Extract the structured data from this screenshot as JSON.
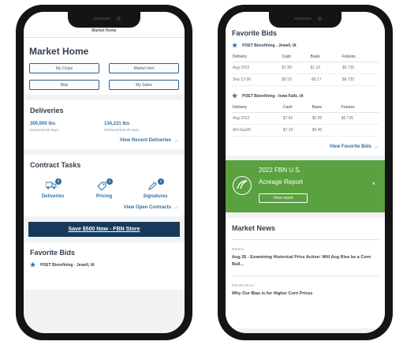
{
  "left_phone": {
    "topbar_title": "Market Home",
    "page_title": "My Crops",
    "market_home_title": "Market Home",
    "quick_buttons": [
      "My Crops",
      "Market Intel",
      "Bids",
      "My Sales"
    ],
    "deliveries": {
      "title": "Deliveries",
      "stats": [
        {
          "value": "300,000 lbs",
          "label": "Delivered 30 days"
        },
        {
          "value": "134,231 lbs",
          "label": "Delivered last 30 days"
        }
      ],
      "link": "View Recent Deliveries"
    },
    "contract_tasks": {
      "title": "Contract Tasks",
      "tasks": [
        {
          "label": "Deliveries",
          "badge": "3",
          "icon": "truck-icon"
        },
        {
          "label": "Pricing",
          "badge": "1",
          "icon": "tag-icon"
        },
        {
          "label": "Signatures",
          "badge": "2",
          "icon": "pen-icon"
        }
      ],
      "link": "View Open Contracts"
    },
    "store_banner": "Save $500 Now - FBN Store",
    "favorite_bids_title": "Favorite Bids",
    "favorite_bids_first": "POET Biorefining - Jewell, IA"
  },
  "right_phone": {
    "favorite_bids": {
      "title": "Favorite Bids",
      "headers": [
        "Delivery",
        "Cash",
        "Basis",
        "Futures"
      ],
      "locations": [
        {
          "name": "POET Biorefining - Jewell, IA",
          "rows": [
            [
              "Aug 2022",
              "$7.83",
              "$1.10",
              "$6.735"
            ],
            [
              "Sep 12-30",
              "$6.53",
              "-$0.17",
              "$6.735"
            ]
          ]
        },
        {
          "name": "POET Biorefining - Iowa Falls, IA",
          "rows": [
            [
              "Aug 2022",
              "$7.65",
              "$0.95",
              "$6.735"
            ],
            [
              "AH-Sep20",
              "$7.19",
              "$0.40",
              ""
            ]
          ]
        }
      ],
      "link": "View Favorite Bids"
    },
    "promo": {
      "line1": "2022 FBN U.S.",
      "line2": "Acreage Report",
      "button": "View report",
      "close": "×"
    },
    "news": {
      "title": "Market News",
      "items": [
        {
          "kicker": "NEWS",
          "headline": "Aug 26 - Examining Historical Price Action: Will Aug Rise be a Corn Bull..."
        },
        {
          "kicker": "RESEARCH",
          "headline": "Why Our Bias is for Higher Corn Prices"
        }
      ]
    }
  },
  "colors": {
    "brand_blue": "#2f6fa6",
    "navy": "#163a5c",
    "promo_green": "#5aa13f"
  }
}
